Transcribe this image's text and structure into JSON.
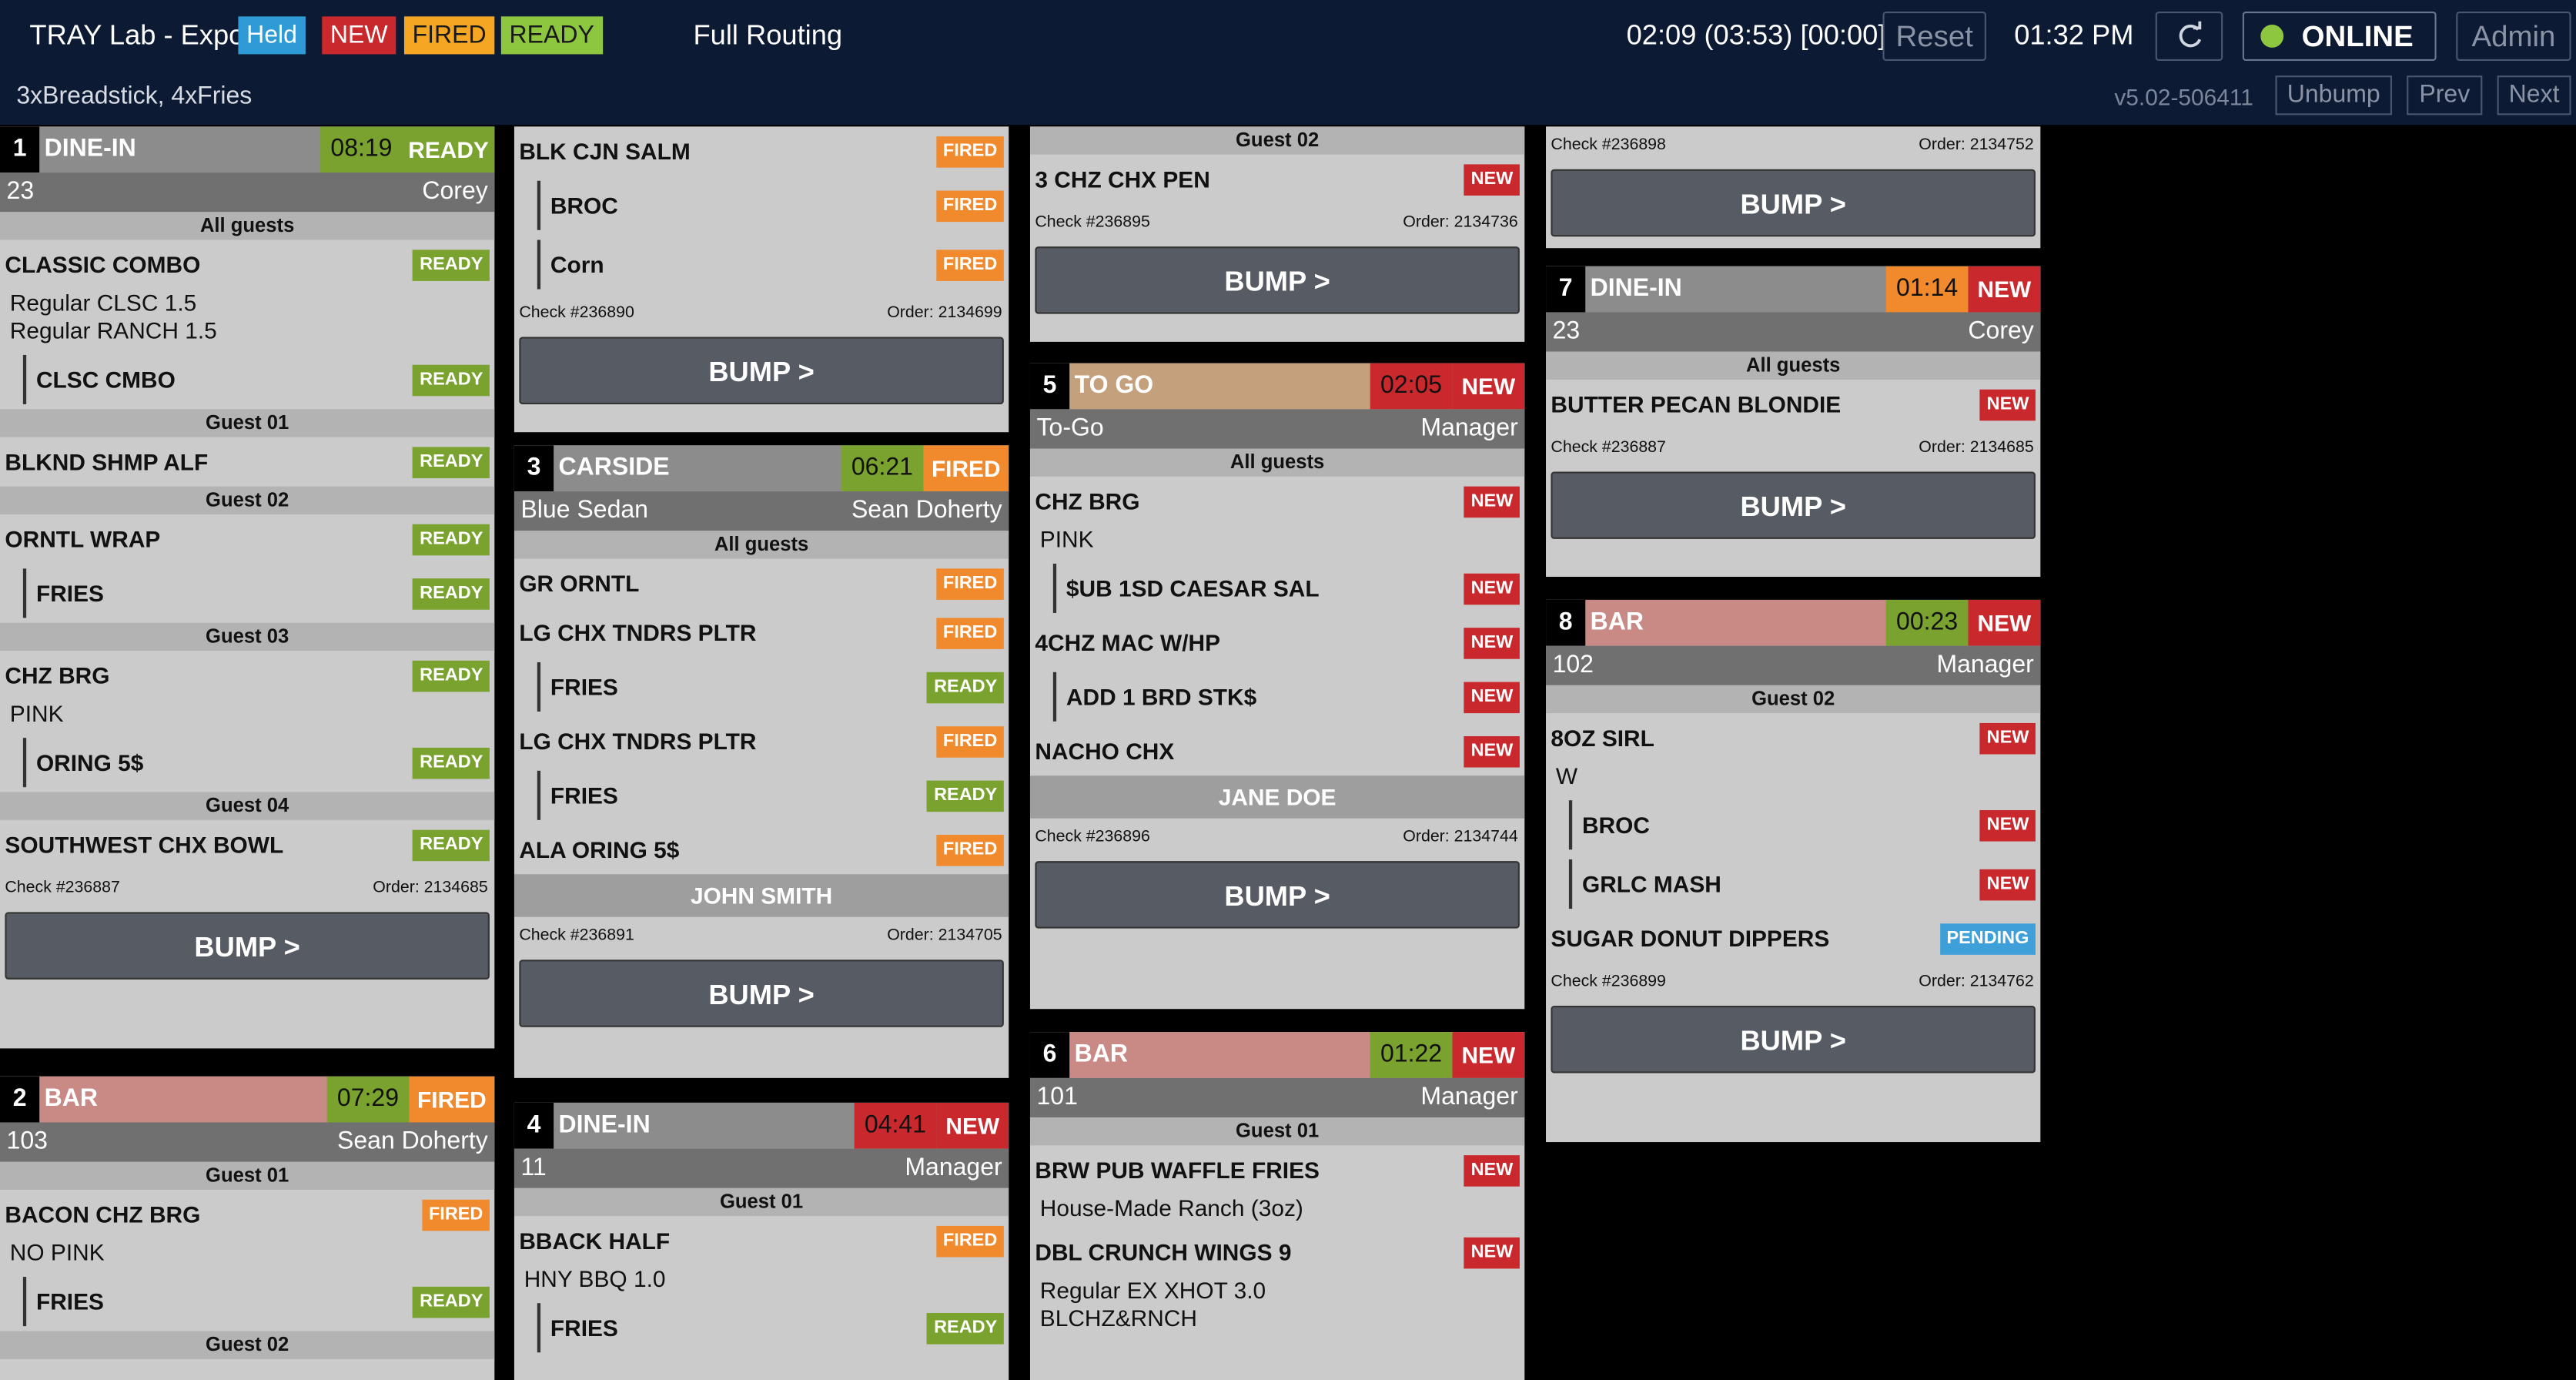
{
  "header": {
    "title": "TRAY Lab - Expo",
    "legend": [
      {
        "label": "Held",
        "color": "#2f9bd6"
      },
      {
        "label": "NEW",
        "color": "#c9282d"
      },
      {
        "label": "FIRED",
        "color": "#f5a623"
      },
      {
        "label": "READY",
        "color": "#8dc63f"
      }
    ],
    "routing": "Full Routing",
    "timers": "02:09 (03:53) [00:00]",
    "reset_label": "Reset",
    "clock": "01:32 PM",
    "refresh_icon": "refresh-icon",
    "online_label": "ONLINE",
    "admin_label": "Admin",
    "summary": "3xBreadstick, 4xFries",
    "version": "v5.02-506411",
    "unbump_label": "Unbump",
    "prev_label": "Prev",
    "next_label": "Next"
  },
  "tickets": [
    {
      "num": "1",
      "type": "DINE-IN",
      "time": "08:19",
      "status": "READY",
      "left": "23",
      "right": "Corey",
      "rows": [
        {
          "k": "g",
          "t": "All guests"
        },
        {
          "k": "i",
          "t": "CLASSIC COMBO",
          "s": "READY"
        },
        {
          "k": "m",
          "l": [
            "Regular CLSC 1.5",
            "Regular RANCH 1.5"
          ]
        },
        {
          "k": "si",
          "t": "CLSC CMBO",
          "s": "READY"
        },
        {
          "k": "g",
          "t": "Guest 01"
        },
        {
          "k": "i",
          "t": "BLKND SHMP ALF",
          "s": "READY"
        },
        {
          "k": "g",
          "t": "Guest 02"
        },
        {
          "k": "i",
          "t": "ORNTL WRAP",
          "s": "READY"
        },
        {
          "k": "si",
          "t": "FRIES",
          "s": "READY"
        },
        {
          "k": "g",
          "t": "Guest 03"
        },
        {
          "k": "i",
          "t": "CHZ BRG",
          "s": "READY"
        },
        {
          "k": "m",
          "l": [
            "PINK"
          ]
        },
        {
          "k": "si",
          "t": "ORING 5$",
          "s": "READY"
        },
        {
          "k": "g",
          "t": "Guest 04"
        },
        {
          "k": "i",
          "t": "SOUTHWEST CHX BOWL",
          "s": "READY"
        }
      ],
      "check": "Check #236887",
      "order": "Order: 2134685",
      "bump": "BUMP >"
    },
    {
      "num": "2",
      "type": "BAR",
      "time": "07:29",
      "status": "FIRED",
      "left": "103",
      "right": "Sean Doherty",
      "rows": [
        {
          "k": "g",
          "t": "Guest 01"
        },
        {
          "k": "i",
          "t": "BACON CHZ BRG",
          "s": "FIRED"
        },
        {
          "k": "m",
          "l": [
            "NO PINK"
          ]
        },
        {
          "k": "si",
          "t": "FRIES",
          "s": "READY"
        },
        {
          "k": "g",
          "t": "Guest 02"
        }
      ]
    },
    {
      "cont": true,
      "rows": [
        {
          "k": "i",
          "t": "BLK CJN SALM",
          "s": "FIRED"
        },
        {
          "k": "si",
          "t": "BROC",
          "s": "FIRED"
        },
        {
          "k": "si",
          "t": "Corn",
          "s": "FIRED"
        }
      ],
      "check": "Check #236890",
      "order": "Order: 2134699",
      "bump": "BUMP >"
    },
    {
      "num": "3",
      "type": "CARSIDE",
      "time": "06:21",
      "status": "FIRED",
      "left": "Blue Sedan",
      "right": "Sean Doherty",
      "rows": [
        {
          "k": "g",
          "t": "All guests"
        },
        {
          "k": "i",
          "t": "GR ORNTL",
          "s": "FIRED"
        },
        {
          "k": "i",
          "t": "LG CHX TNDRS PLTR",
          "s": "FIRED"
        },
        {
          "k": "si",
          "t": "FRIES",
          "s": "READY"
        },
        {
          "k": "i",
          "t": "LG CHX TNDRS PLTR",
          "s": "FIRED"
        },
        {
          "k": "si",
          "t": "FRIES",
          "s": "READY"
        },
        {
          "k": "i",
          "t": "ALA ORING 5$",
          "s": "FIRED"
        },
        {
          "k": "n",
          "t": "JOHN SMITH"
        }
      ],
      "check": "Check #236891",
      "order": "Order: 2134705",
      "bump": "BUMP >"
    },
    {
      "num": "4",
      "type": "DINE-IN",
      "time": "04:41",
      "status": "NEW",
      "left": "11",
      "right": "Manager",
      "rows": [
        {
          "k": "g",
          "t": "Guest 01"
        },
        {
          "k": "i",
          "t": "BBACK HALF",
          "s": "FIRED"
        },
        {
          "k": "m",
          "l": [
            "HNY BBQ 1.0"
          ]
        },
        {
          "k": "si",
          "t": "FRIES",
          "s": "READY"
        }
      ]
    },
    {
      "cont": true,
      "rows": [
        {
          "k": "g",
          "t": "Guest 02"
        },
        {
          "k": "i",
          "t": "3 CHZ CHX PEN",
          "s": "NEW"
        }
      ],
      "check": "Check #236895",
      "order": "Order: 2134736",
      "bump": "BUMP >"
    },
    {
      "num": "5",
      "type": "TO GO",
      "time": "02:05",
      "status": "NEW",
      "left": "To-Go",
      "right": "Manager",
      "rows": [
        {
          "k": "g",
          "t": "All guests"
        },
        {
          "k": "i",
          "t": "CHZ BRG",
          "s": "NEW"
        },
        {
          "k": "m",
          "l": [
            "PINK"
          ]
        },
        {
          "k": "si",
          "t": "$UB 1SD CAESAR SAL",
          "s": "NEW"
        },
        {
          "k": "i",
          "t": "4CHZ MAC W/HP",
          "s": "NEW"
        },
        {
          "k": "si",
          "t": "ADD 1 BRD STK$",
          "s": "NEW"
        },
        {
          "k": "i",
          "t": "NACHO CHX",
          "s": "NEW"
        },
        {
          "k": "n",
          "t": "JANE DOE"
        }
      ],
      "check": "Check #236896",
      "order": "Order: 2134744",
      "bump": "BUMP >"
    },
    {
      "num": "6",
      "type": "BAR",
      "time": "01:22",
      "status": "NEW",
      "left": "101",
      "right": "Manager",
      "rows": [
        {
          "k": "g",
          "t": "Guest 01"
        },
        {
          "k": "i",
          "t": "BRW PUB WAFFLE FRIES",
          "s": "NEW"
        },
        {
          "k": "m",
          "l": [
            "House-Made Ranch (3oz)"
          ]
        },
        {
          "k": "i",
          "t": "DBL CRUNCH WINGS 9",
          "s": "NEW"
        },
        {
          "k": "m",
          "l": [
            " Regular EX XHOT 3.0",
            "BLCHZ&RNCH"
          ]
        }
      ]
    },
    {
      "cont": true,
      "rows": [],
      "check": "Check #236898",
      "order": "Order: 2134752",
      "bump": "BUMP >"
    },
    {
      "num": "7",
      "type": "DINE-IN",
      "time": "01:14",
      "status": "NEW",
      "left": "23",
      "right": "Corey",
      "rows": [
        {
          "k": "g",
          "t": "All guests"
        },
        {
          "k": "i",
          "t": "BUTTER PECAN BLONDIE",
          "s": "NEW"
        }
      ],
      "check": "Check #236887",
      "order": "Order: 2134685",
      "bump": "BUMP >"
    },
    {
      "num": "8",
      "type": "BAR",
      "time": "00:23",
      "status": "NEW",
      "left": "102",
      "right": "Manager",
      "rows": [
        {
          "k": "g",
          "t": "Guest 02"
        },
        {
          "k": "i",
          "t": "8OZ SIRL",
          "s": "NEW"
        },
        {
          "k": "m",
          "l": [
            "W"
          ]
        },
        {
          "k": "si",
          "t": "BROC",
          "s": "NEW"
        },
        {
          "k": "si",
          "t": "GRLC MASH",
          "s": "NEW"
        },
        {
          "k": "i",
          "t": "SUGAR DONUT DIPPERS",
          "s": "PENDING"
        }
      ],
      "check": "Check #236899",
      "order": "Order: 2134762",
      "bump": "BUMP >"
    }
  ],
  "colors": {
    "type_bar": {
      "DINE-IN": "#8c8c8c",
      "BAR": "#c98a86",
      "CARSIDE": "#8c8c8c",
      "TO GO": "#c4a07c"
    },
    "time_bg": {
      "green": "#7aa22e",
      "orange": "#f08a2c",
      "red": "#c9282d"
    },
    "status_bg": {
      "READY": "#7aa22e",
      "FIRED": "#f08a2c",
      "NEW": "#c9282d",
      "PENDING": "#3f9fd8"
    }
  }
}
